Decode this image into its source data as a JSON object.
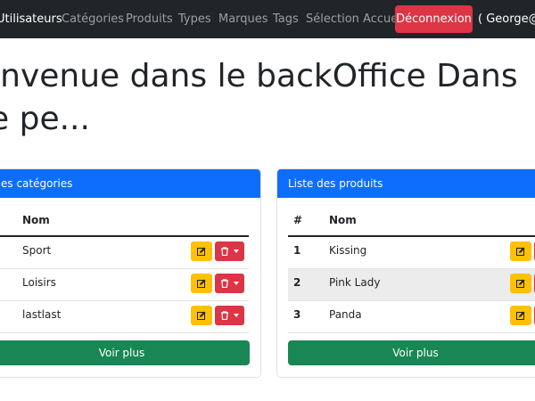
{
  "navbar": {
    "links": [
      {
        "label": "Utilisateurs",
        "active": true
      },
      {
        "label": "Catégories"
      },
      {
        "label": "Produits"
      },
      {
        "label": "Types"
      },
      {
        "label": "Marques"
      },
      {
        "label": "Tags"
      },
      {
        "label": "Sélection Accueil"
      }
    ],
    "logout_label": "Déconnexion",
    "user_text": "( George@a"
  },
  "page": {
    "title": "envenue dans le backOffice Dans le pe..."
  },
  "categories_card": {
    "header": "es catégories",
    "col_name": "Nom",
    "rows": [
      {
        "name": "Sport"
      },
      {
        "name": "Loisirs"
      },
      {
        "name": "lastlast"
      }
    ],
    "voir_plus": "Voir plus"
  },
  "products_card": {
    "header": "Liste des produits",
    "col_num": "#",
    "col_name": "Nom",
    "rows": [
      {
        "num": "1",
        "name": "Kissing"
      },
      {
        "num": "2",
        "name": "Pink Lady"
      },
      {
        "num": "3",
        "name": "Panda"
      }
    ],
    "voir_plus": "Voir plus"
  },
  "colors": {
    "navbar": "#212529",
    "primary": "#0d6efd",
    "danger": "#dc3545",
    "warning": "#ffc107",
    "success": "#198754"
  },
  "icons": {
    "edit": "pencil-square-icon",
    "delete": "trash-icon",
    "dropdown": "caret-down-icon"
  }
}
